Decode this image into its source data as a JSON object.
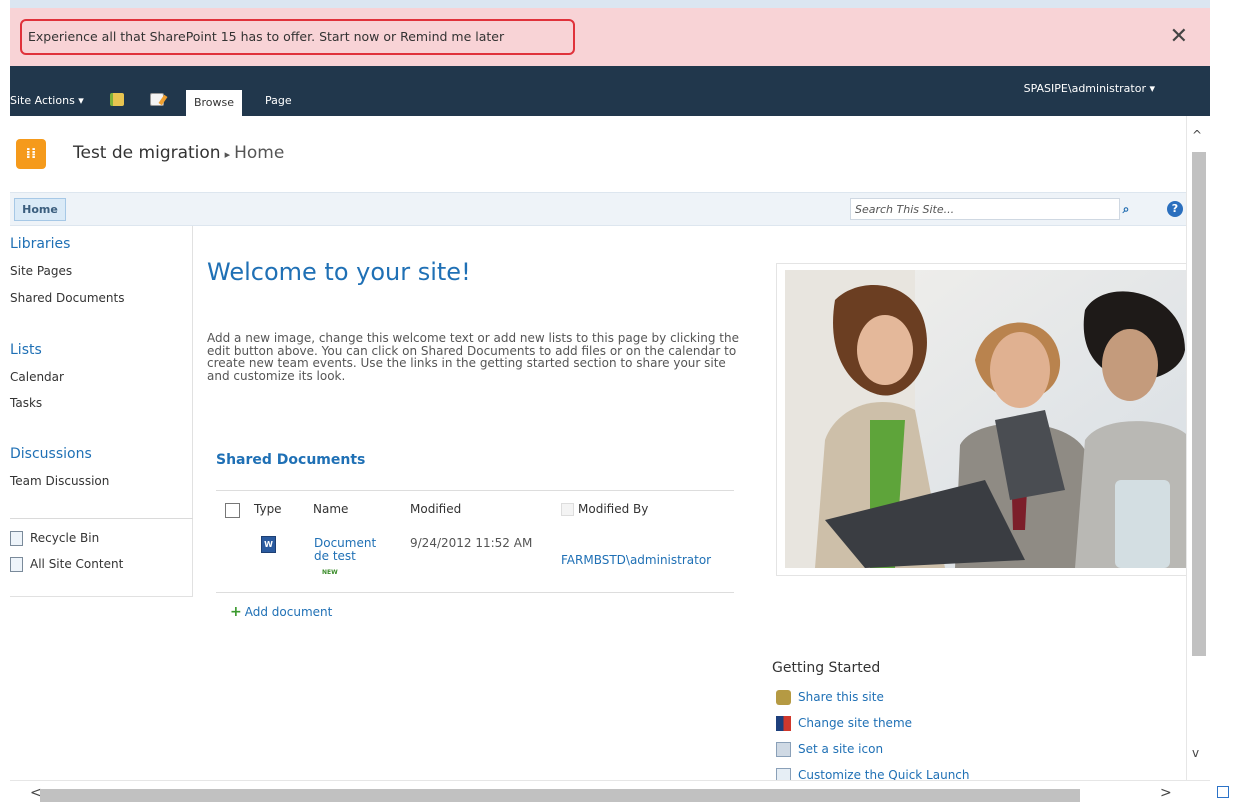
{
  "banner": {
    "text": "Experience all that SharePoint 15 has to offer. ",
    "start_link": "Start now",
    "or_text": " or ",
    "remind_link": "Remind me later",
    "close_glyph": "✕"
  },
  "ribbon": {
    "site_actions": "Site Actions ▾",
    "tabs": [
      "Browse",
      "Page"
    ],
    "user": "SPASIPE\\administrator ▾",
    "icons": [
      "navigate-up-icon",
      "edit-page-icon"
    ]
  },
  "title_area": {
    "site_title": "Test de migration",
    "separator": "▸",
    "current_page": "Home"
  },
  "top_nav": {
    "home_tab": "Home",
    "search_placeholder": "Search This Site...",
    "help_glyph": "?"
  },
  "quick_launch": {
    "libraries_heading": "Libraries",
    "libraries": [
      "Site Pages",
      "Shared Documents"
    ],
    "lists_heading": "Lists",
    "lists": [
      "Calendar",
      "Tasks"
    ],
    "discussions_heading": "Discussions",
    "discussions": [
      "Team Discussion"
    ],
    "recycle_bin": "Recycle Bin",
    "all_site_content": "All Site Content"
  },
  "main": {
    "welcome_title": "Welcome to your site!",
    "intro_text": "Add a new image, change this welcome text or add new lists to this page by clicking the edit button above. You can click on Shared Documents to add files or on the calendar to create new team events. Use the links in the getting started section to share your site and customize its look."
  },
  "shared_documents": {
    "title": "Shared Documents",
    "columns": [
      "Type",
      "Name",
      "Modified",
      "Modified By"
    ],
    "rows": [
      {
        "name": "Document de test",
        "new_badge": "NEW",
        "modified": "9/24/2012 11:52 AM",
        "modified_by": "FARMBSTD\\administrator"
      }
    ],
    "add_document": "Add document"
  },
  "getting_started": {
    "title": "Getting Started",
    "items": [
      "Share this site",
      "Change site theme",
      "Set a site icon",
      "Customize the Quick Launch"
    ]
  },
  "colors": {
    "banner_bg": "#f8d3d6",
    "banner_border": "#e0323b",
    "ribbon_bg": "#21374c",
    "link_blue": "#1f70b5",
    "logo_orange": "#f59a1b"
  }
}
